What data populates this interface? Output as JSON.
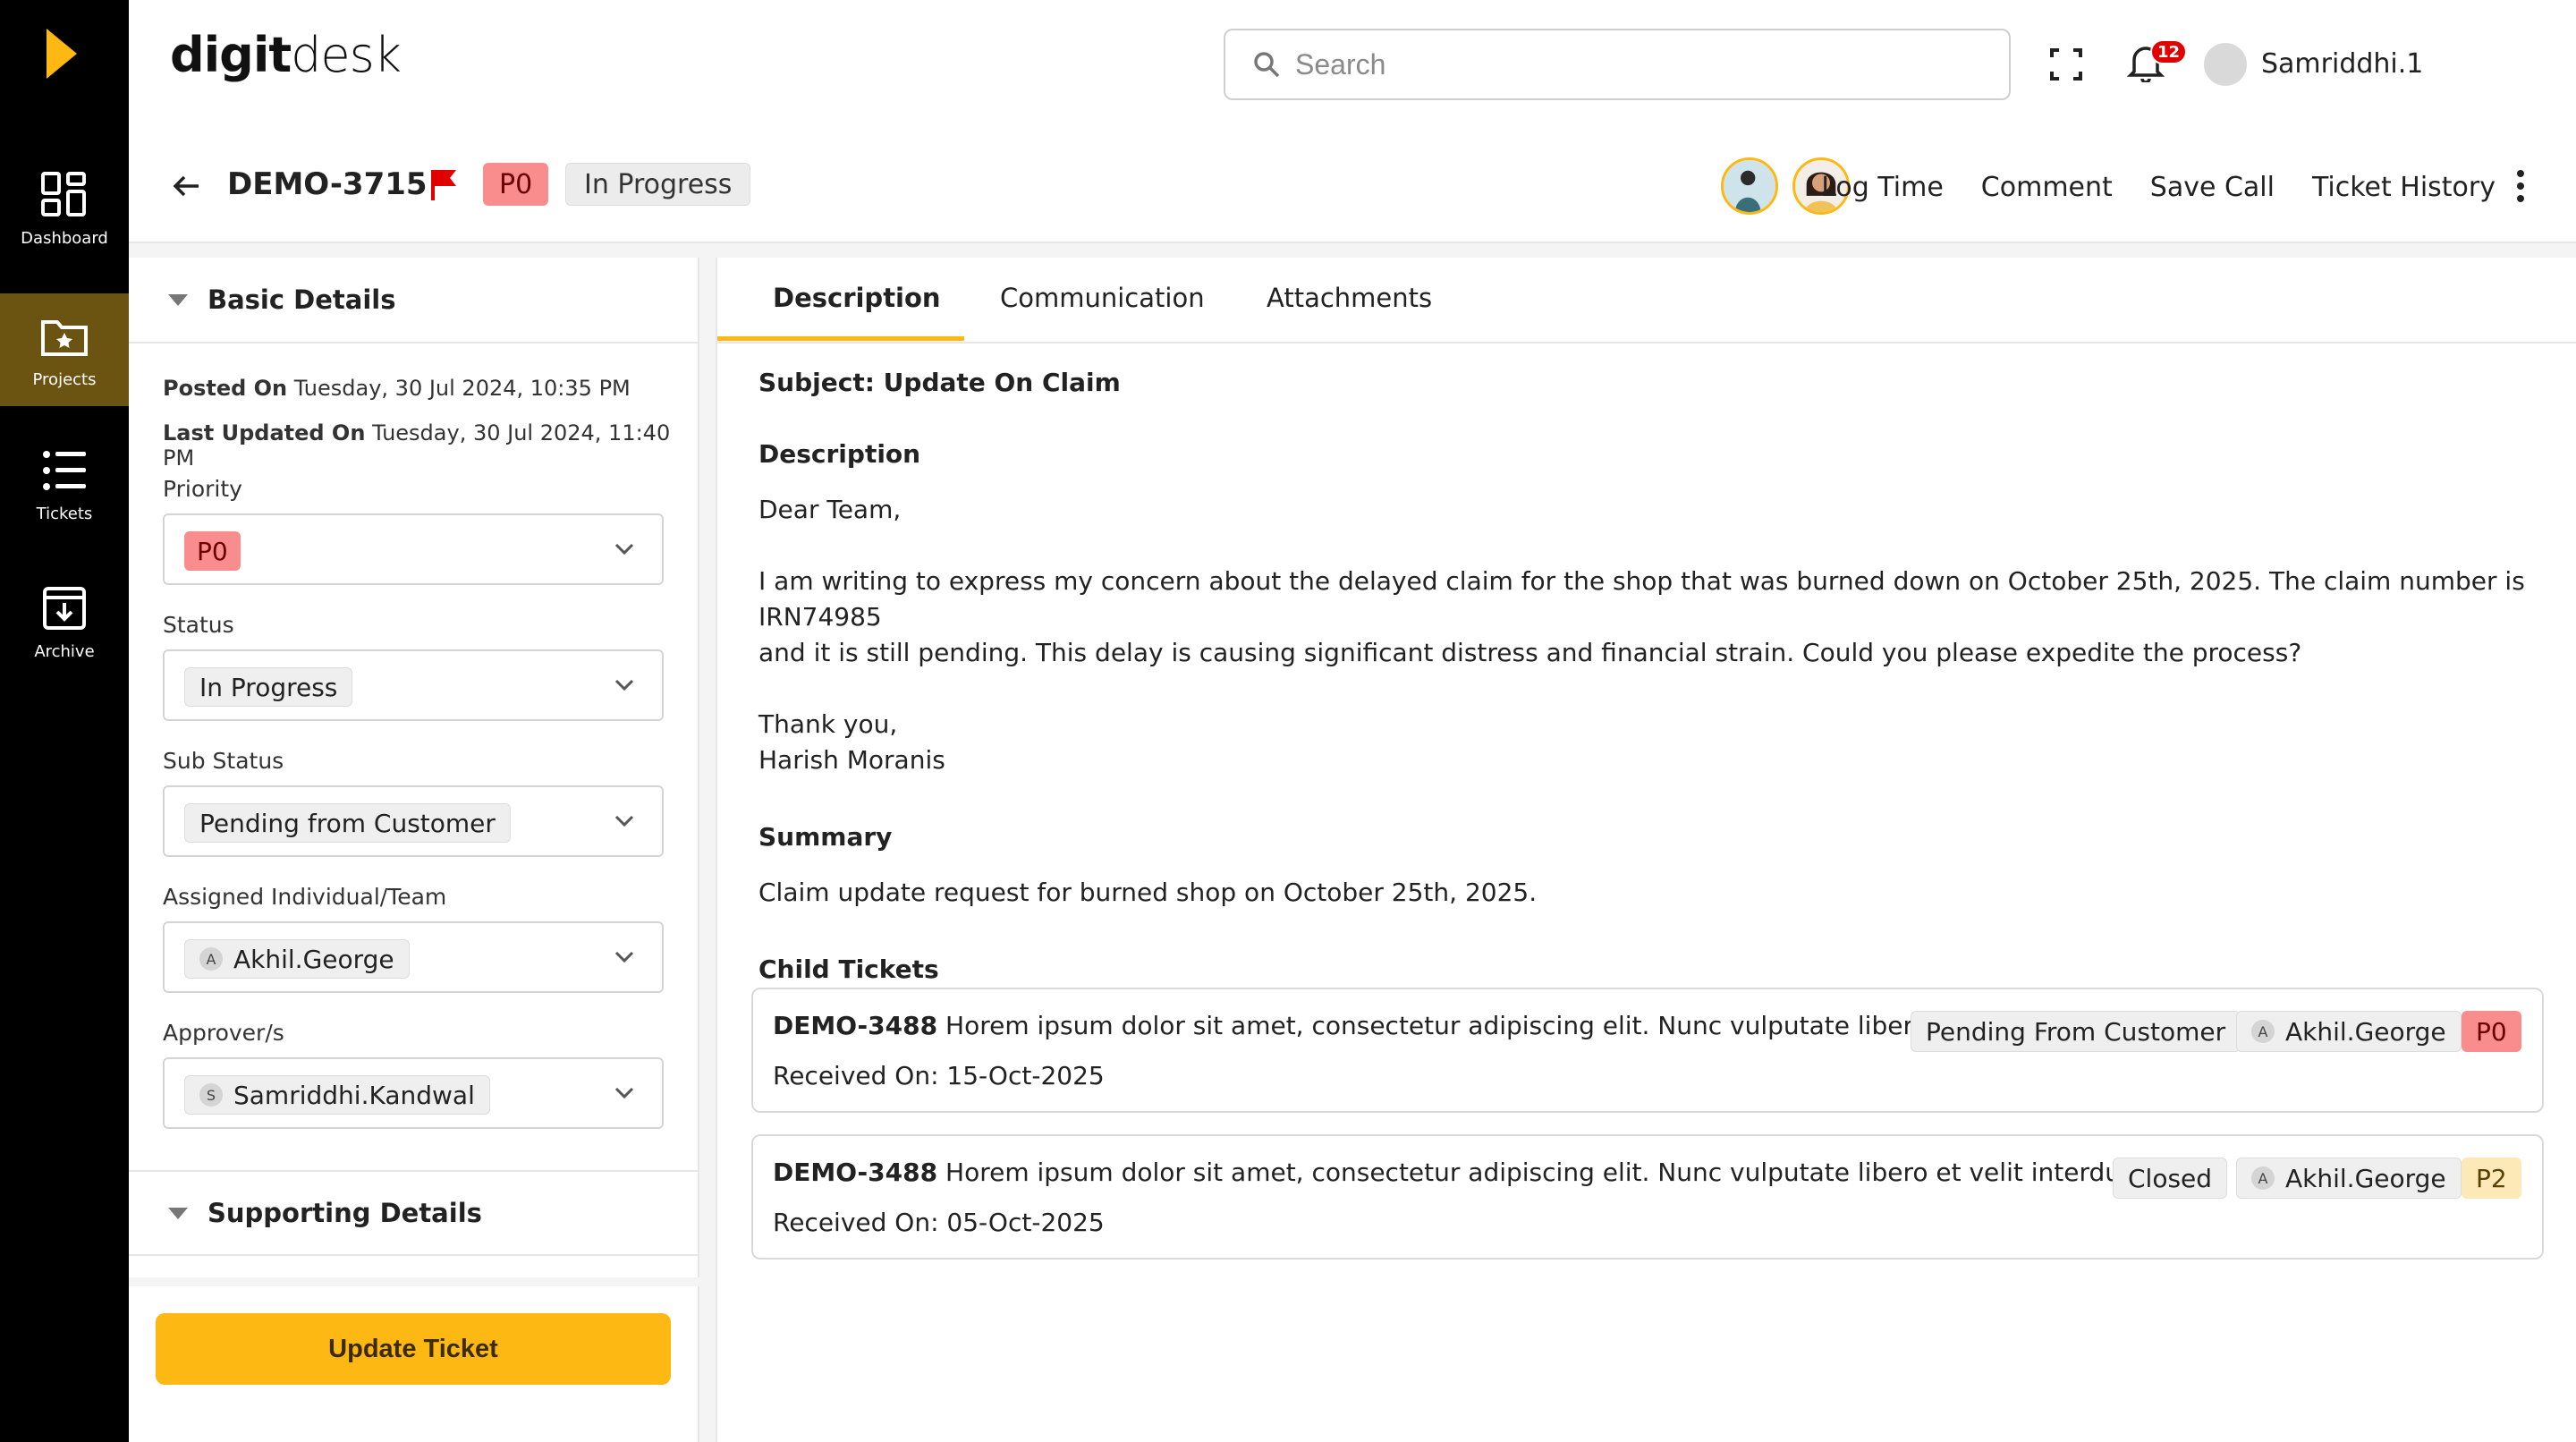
{
  "sidebar": {
    "items": [
      {
        "label": "Dashboard",
        "icon": "dashboard-icon"
      },
      {
        "label": "Projects",
        "icon": "folder-star-icon"
      },
      {
        "label": "Tickets",
        "icon": "list-icon"
      },
      {
        "label": "Archive",
        "icon": "archive-icon"
      }
    ],
    "active": "Projects"
  },
  "header": {
    "brand_bold": "digit",
    "brand_light": "desk",
    "search_placeholder": "Search",
    "notification_count": "12",
    "user_name": "Samriddhi.1"
  },
  "ticket": {
    "id": "DEMO-3715",
    "priority": "P0",
    "status": "In Progress",
    "actions": [
      "Log Time",
      "Comment",
      "Save Call",
      "Ticket History"
    ]
  },
  "basic_details": {
    "title": "Basic Details",
    "posted_on_label": "Posted On",
    "posted_on": "Tuesday, 30 Jul 2024, 10:35 PM",
    "last_updated_label": "Last Updated On",
    "last_updated": "Tuesday, 30 Jul 2024, 11:40 PM",
    "priority_label": "Priority",
    "priority_value": "P0",
    "status_label": "Status",
    "status_value": "In Progress",
    "sub_status_label": "Sub Status",
    "sub_status_value": "Pending from Customer",
    "assigned_label": "Assigned Individual/Team",
    "assigned_initial": "A",
    "assigned_value": "Akhil.George",
    "approver_label": "Approver/s",
    "approver_initial": "S",
    "approver_value": "Samriddhi.Kandwal"
  },
  "supporting_details": {
    "title": "Supporting Details"
  },
  "update_button": "Update Ticket",
  "tabs": [
    "Description",
    "Communication",
    "Attachments"
  ],
  "description": {
    "subject": "Subject: Update On Claim",
    "heading": "Description",
    "greeting": "Dear Team,",
    "body_line1": "I am writing to express my concern about the delayed claim for the shop that was burned down on October 25th, 2025. The claim number is IRN74985",
    "body_line2": "and it is still pending. This delay is causing significant distress and financial strain. Could you please expedite the process?",
    "signoff": "Thank you,",
    "signature": "Harish Moranis",
    "summary_heading": "Summary",
    "summary": "Claim update request for burned shop on October 25th, 2025.",
    "child_heading": "Child Tickets"
  },
  "child_tickets": [
    {
      "id": "DEMO-3488",
      "text": "Horem ipsum dolor sit amet, consectetur adipiscing elit. Nunc vulputate libero et...",
      "received": "Received On: 15-Oct-2025",
      "status": "Pending From Customer",
      "assignee_initial": "A",
      "assignee": "Akhil.George",
      "priority": "P0"
    },
    {
      "id": "DEMO-3488",
      "text": "Horem ipsum dolor sit amet, consectetur adipiscing elit. Nunc vulputate libero et velit interdum, ac...",
      "received": "Received On: 05-Oct-2025",
      "status": "Closed",
      "assignee_initial": "A",
      "assignee": "Akhil.George",
      "priority": "P2"
    }
  ],
  "colors": {
    "accent": "#FDB813",
    "sidebar_bg": "#000000",
    "sidebar_active": "#6b5312",
    "p0": "#f98c8c",
    "p2": "#fde9b8",
    "flag": "#e00000"
  }
}
